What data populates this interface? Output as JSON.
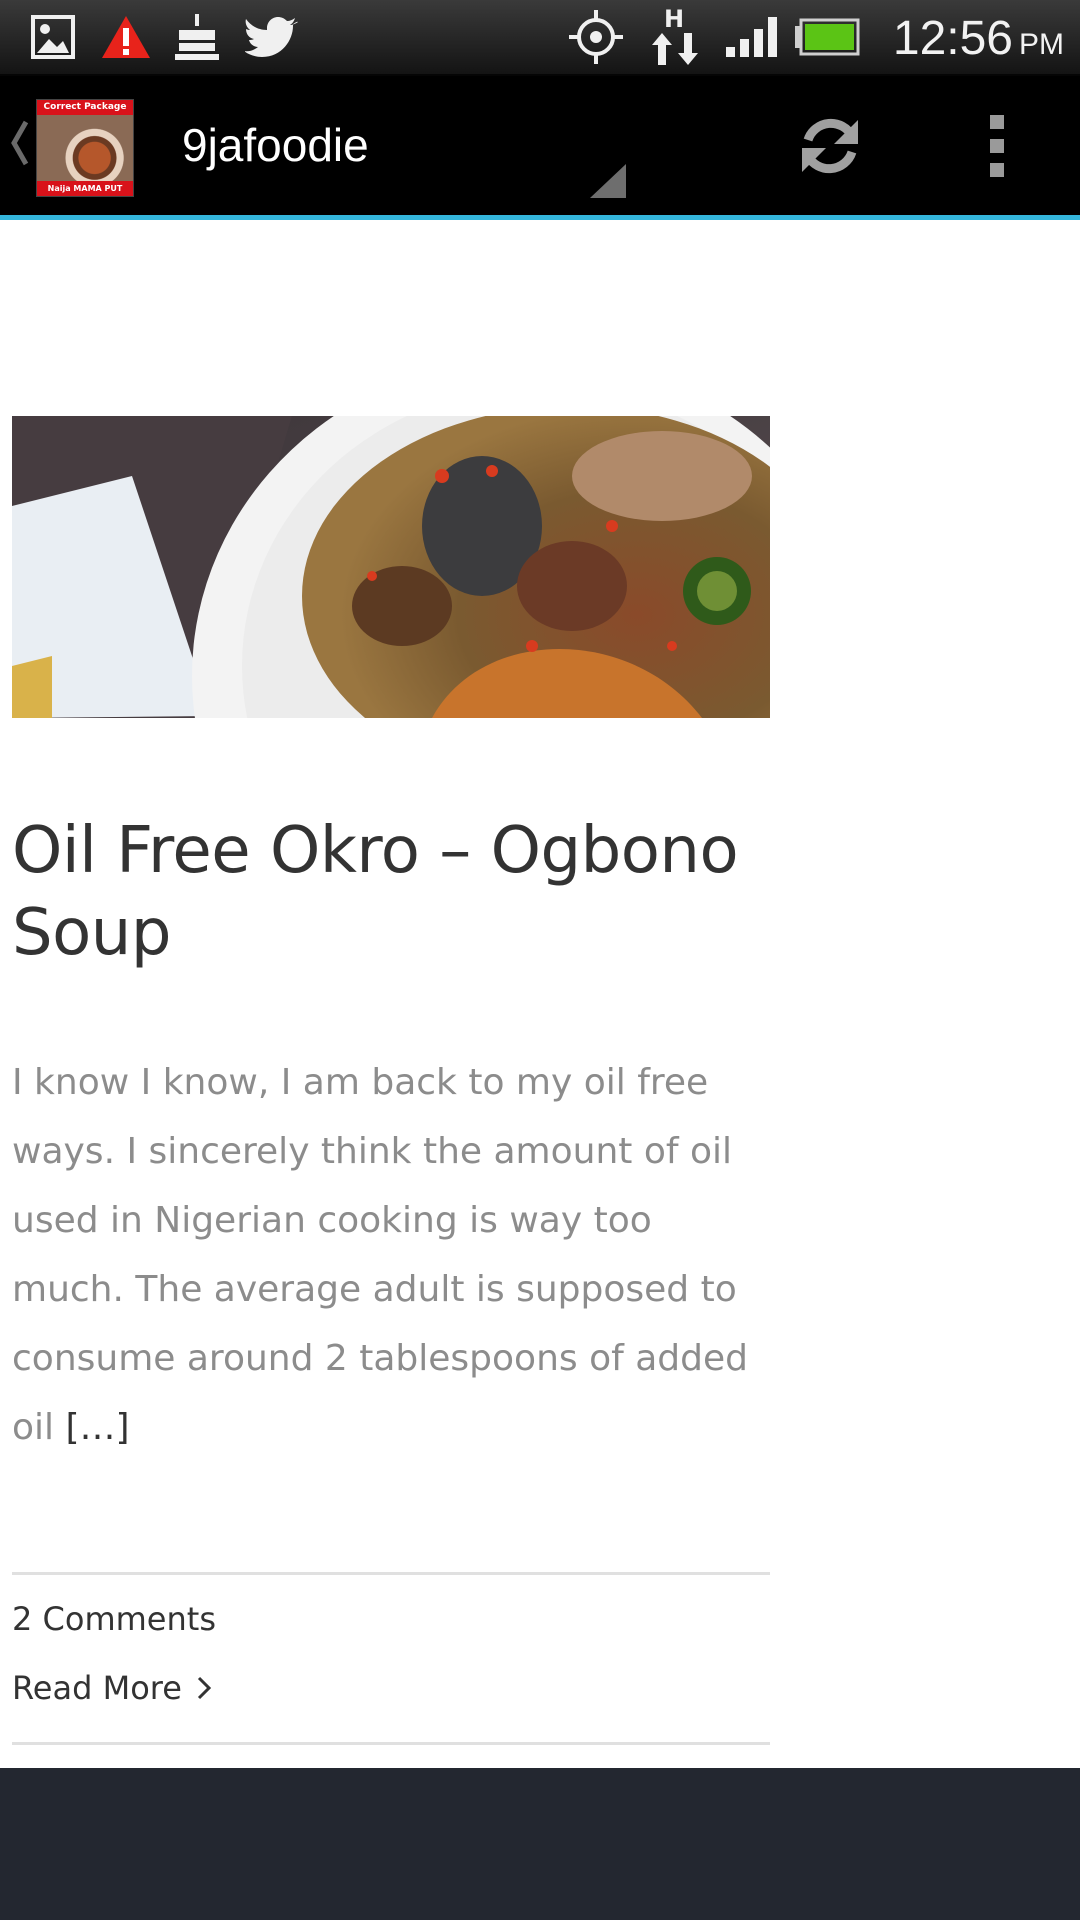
{
  "status_bar": {
    "time": "12:56",
    "ampm": "PM",
    "icons": [
      "gallery-icon",
      "warning-icon",
      "birthday-cake-icon",
      "twitter-icon",
      "gps-icon",
      "hspa-data-icon",
      "signal-strength-icon",
      "battery-icon"
    ]
  },
  "action_bar": {
    "title": "9jafoodie",
    "logo": {
      "top_text": "Correct Package",
      "bottom_text": "Naija MAMA PUT"
    },
    "actions": [
      "refresh-icon",
      "overflow-menu-icon"
    ],
    "accent_color": "#34b6dc"
  },
  "post": {
    "title": "Oil Free Okro – Ogbono Soup",
    "excerpt": "I know I know, I am back to my oil free ways. I sincerely think the amount of oil used in Nigerian cooking is way too much. The average adult is supposed to consume around 2 tablespoons of added oil",
    "excerpt_more": "[…]",
    "comments": "2 Comments",
    "read_more": "Read More"
  },
  "colors": {
    "footer": "#232730",
    "title_text": "#333333",
    "excerpt_text": "#8c8c8c"
  }
}
